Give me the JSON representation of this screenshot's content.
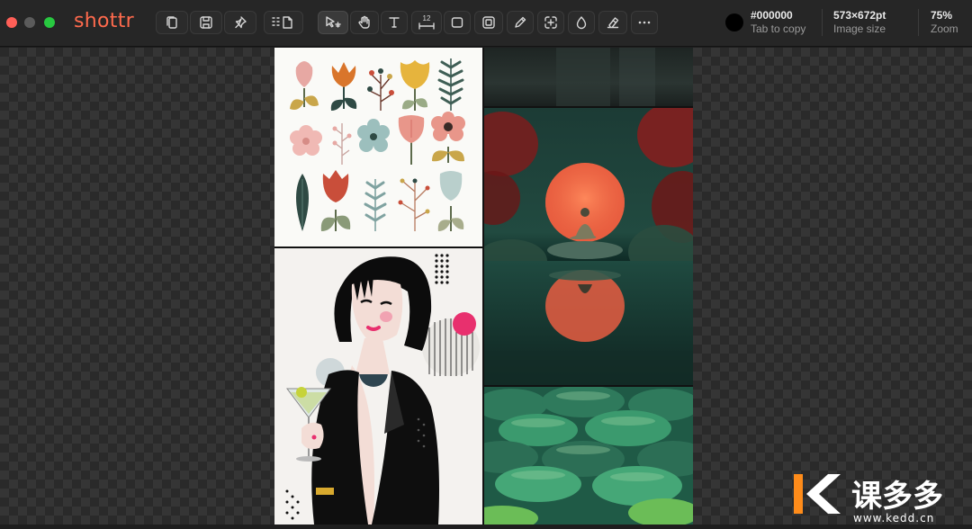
{
  "app": {
    "title": "shottr"
  },
  "toolbar": {
    "groups": [
      {
        "name": "actions",
        "tools": [
          "copy-icon",
          "save-icon",
          "pin-icon",
          "layout-icon"
        ]
      },
      {
        "name": "annotate",
        "tools": [
          "select-icon",
          "hand-icon",
          "text-icon",
          "ruler-icon",
          "rectangle-icon",
          "spotlight-icon",
          "pen-icon",
          "crop-icon",
          "blur-icon",
          "eraser-icon",
          "more-icon"
        ]
      }
    ],
    "ruler_label": "12",
    "active_tool": "select-icon"
  },
  "status": {
    "color_value": "#000000",
    "color_hint": "Tab to copy",
    "image_size_value": "573×672pt",
    "image_size_label": "Image size",
    "zoom_value": "75%",
    "zoom_label": "Zoom"
  },
  "watermark": {
    "logo_text": "课多多",
    "url": "www.kedd.cn"
  },
  "colors": {
    "brand": "#ff6a4d",
    "toolbar_bg": "#262626",
    "canvas_checker_a": "#2a2a2a",
    "canvas_checker_b": "#353535"
  }
}
